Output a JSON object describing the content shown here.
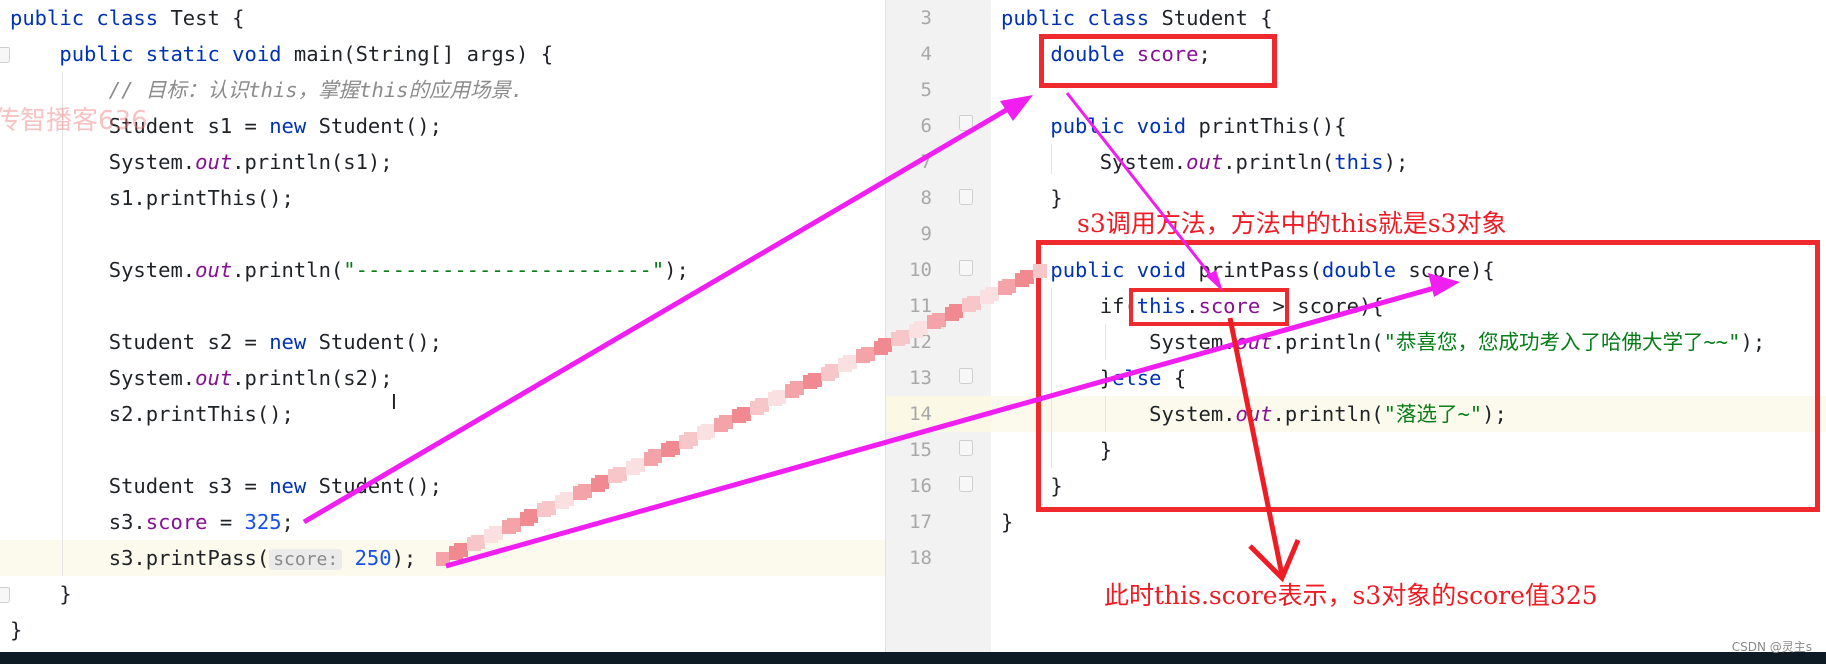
{
  "watermark": "传智播客636",
  "left_editor": {
    "file_class": "Test",
    "lines": [
      {
        "tokens": [
          {
            "t": "public class ",
            "c": "kw"
          },
          {
            "t": "Test {",
            "c": ""
          }
        ]
      },
      {
        "tokens": [
          {
            "t": "    public static void ",
            "c": "kw"
          },
          {
            "t": "main(String[] args) {",
            "c": ""
          }
        ]
      },
      {
        "tokens": [
          {
            "t": "        // 目标：认识this，掌握this的应用场景.",
            "c": "cmt"
          }
        ]
      },
      {
        "tokens": [
          {
            "t": "        Student s1 = ",
            "c": ""
          },
          {
            "t": "new ",
            "c": "kw"
          },
          {
            "t": "Student();",
            "c": ""
          }
        ]
      },
      {
        "tokens": [
          {
            "t": "        System.",
            "c": ""
          },
          {
            "t": "out",
            "c": "itl"
          },
          {
            "t": ".println(s1);",
            "c": ""
          }
        ]
      },
      {
        "tokens": [
          {
            "t": "        s1.printThis();",
            "c": ""
          }
        ]
      },
      {
        "tokens": []
      },
      {
        "tokens": [
          {
            "t": "        System.",
            "c": ""
          },
          {
            "t": "out",
            "c": "itl"
          },
          {
            "t": ".println(",
            "c": ""
          },
          {
            "t": "\"------------------------\"",
            "c": "str"
          },
          {
            "t": ");",
            "c": ""
          }
        ]
      },
      {
        "tokens": []
      },
      {
        "tokens": [
          {
            "t": "        Student s2 = ",
            "c": ""
          },
          {
            "t": "new ",
            "c": "kw"
          },
          {
            "t": "Student();",
            "c": ""
          }
        ]
      },
      {
        "tokens": [
          {
            "t": "        System.",
            "c": ""
          },
          {
            "t": "out",
            "c": "itl"
          },
          {
            "t": ".println(s2);",
            "c": ""
          }
        ]
      },
      {
        "tokens": [
          {
            "t": "        s2.printThis();",
            "c": ""
          }
        ]
      },
      {
        "tokens": []
      },
      {
        "tokens": [
          {
            "t": "        Student s3 = ",
            "c": ""
          },
          {
            "t": "new ",
            "c": "kw"
          },
          {
            "t": "Student();",
            "c": ""
          }
        ]
      },
      {
        "tokens": [
          {
            "t": "        s3.",
            "c": ""
          },
          {
            "t": "score",
            "c": "fld"
          },
          {
            "t": " = ",
            "c": ""
          },
          {
            "t": "325",
            "c": "num"
          },
          {
            "t": ";",
            "c": ""
          }
        ]
      },
      {
        "tokens": [
          {
            "t": "        s3.printPass(",
            "c": ""
          },
          {
            "t": "score:",
            "c": "hint"
          },
          {
            "t": " ",
            "c": ""
          },
          {
            "t": "250",
            "c": "num"
          },
          {
            "t": ");",
            "c": ""
          }
        ]
      },
      {
        "tokens": [
          {
            "t": "    }",
            "c": ""
          }
        ]
      },
      {
        "tokens": [
          {
            "t": "}",
            "c": ""
          }
        ]
      }
    ],
    "highlighted_line": 15
  },
  "right_editor": {
    "file_class": "Student",
    "line_numbers": [
      "3",
      "4",
      "5",
      "6",
      "7",
      "8",
      "9",
      "10",
      "11",
      "12",
      "13",
      "14",
      "15",
      "16",
      "17",
      "18"
    ],
    "lines": [
      {
        "tokens": [
          {
            "t": "public class ",
            "c": "kw"
          },
          {
            "t": "Student {",
            "c": ""
          }
        ]
      },
      {
        "tokens": [
          {
            "t": "    double ",
            "c": "kw"
          },
          {
            "t": "score",
            "c": "fld"
          },
          {
            "t": ";",
            "c": ""
          }
        ]
      },
      {
        "tokens": []
      },
      {
        "tokens": [
          {
            "t": "    public void ",
            "c": "kw"
          },
          {
            "t": "printThis(){",
            "c": ""
          }
        ]
      },
      {
        "tokens": [
          {
            "t": "        System.",
            "c": ""
          },
          {
            "t": "out",
            "c": "itl"
          },
          {
            "t": ".println(",
            "c": ""
          },
          {
            "t": "this",
            "c": "kw"
          },
          {
            "t": ");",
            "c": ""
          }
        ]
      },
      {
        "tokens": [
          {
            "t": "    }",
            "c": ""
          }
        ]
      },
      {
        "tokens": []
      },
      {
        "tokens": [
          {
            "t": "    public void ",
            "c": "kw"
          },
          {
            "t": "printPass(",
            "c": ""
          },
          {
            "t": "double ",
            "c": "kw"
          },
          {
            "t": "score){",
            "c": ""
          }
        ]
      },
      {
        "tokens": [
          {
            "t": "        if(",
            "c": ""
          },
          {
            "t": "this",
            "c": "kw"
          },
          {
            "t": ".",
            "c": ""
          },
          {
            "t": "score",
            "c": "fld"
          },
          {
            "t": " > score){",
            "c": ""
          }
        ]
      },
      {
        "tokens": [
          {
            "t": "            System.",
            "c": ""
          },
          {
            "t": "out",
            "c": "itl"
          },
          {
            "t": ".println(",
            "c": ""
          },
          {
            "t": "\"恭喜您，您成功考入了哈佛大学了~~\"",
            "c": "str"
          },
          {
            "t": ");",
            "c": ""
          }
        ]
      },
      {
        "tokens": [
          {
            "t": "        }",
            "c": ""
          },
          {
            "t": "else ",
            "c": "kw"
          },
          {
            "t": "{",
            "c": ""
          }
        ]
      },
      {
        "tokens": [
          {
            "t": "            System.",
            "c": ""
          },
          {
            "t": "out",
            "c": "itl"
          },
          {
            "t": ".println(",
            "c": ""
          },
          {
            "t": "\"落选了~\"",
            "c": "str"
          },
          {
            "t": ");",
            "c": ""
          }
        ]
      },
      {
        "tokens": [
          {
            "t": "        }",
            "c": ""
          }
        ]
      },
      {
        "tokens": [
          {
            "t": "    }",
            "c": ""
          }
        ]
      },
      {
        "tokens": [
          {
            "t": "}",
            "c": ""
          }
        ]
      },
      {
        "tokens": []
      }
    ],
    "highlighted_line_number": "14"
  },
  "annotations": {
    "top_note": "s3调用方法，方法中的this就是s3对象",
    "bottom_note": "此时this.score表示，s3对象的score值325"
  },
  "colors": {
    "arrow_magenta": "#f01ef0",
    "annotation_red": "#ee1c25",
    "keyword_blue": "#0033b3",
    "field_purple": "#871094",
    "string_green": "#067d17",
    "number_blue": "#1750eb"
  },
  "credit": "CSDN @灵主s"
}
